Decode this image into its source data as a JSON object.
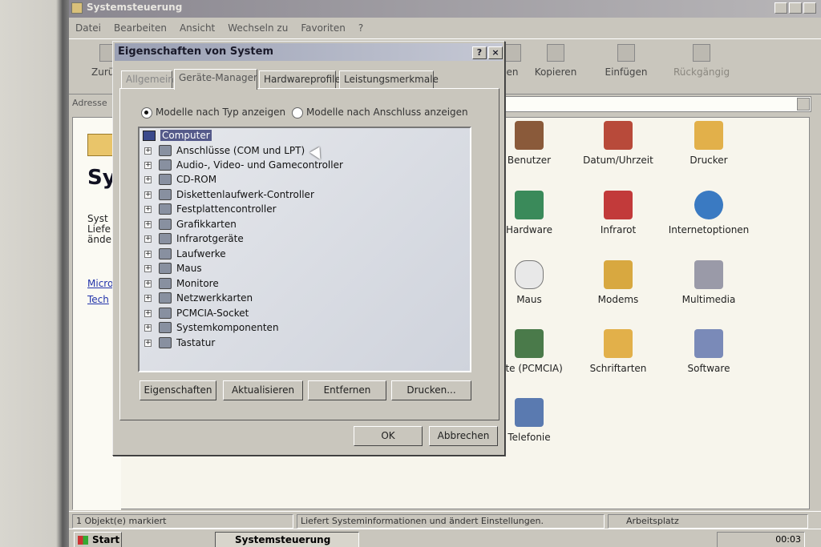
{
  "colors": {
    "dialog_title_bg": "#9aa0b4",
    "panel": "#c9c6bd",
    "selection": "#555a8a"
  },
  "control_panel": {
    "title": "Systemsteuerung",
    "menu": [
      "Datei",
      "Bearbeiten",
      "Ansicht",
      "Wechseln zu",
      "Favoriten",
      "?"
    ],
    "toolbar": [
      {
        "label": "Zurück",
        "icon": "back-arrow-icon"
      },
      {
        "label": "en",
        "icon": "cut-icon"
      },
      {
        "label": "Kopieren",
        "icon": "copy-icon"
      },
      {
        "label": "Einfügen",
        "icon": "paste-icon"
      },
      {
        "label": "Rückgängig",
        "icon": "undo-icon"
      }
    ],
    "address_label": "Adresse",
    "left_pane": {
      "heading": "Sy",
      "sub": "Syst\nLiefe\nände",
      "links": [
        "Micro",
        "Tech"
      ]
    },
    "icons": [
      {
        "label": "Benutzer",
        "icon": "users-icon",
        "color": "#8a5a3a"
      },
      {
        "label": "Datum/Uhrzeit",
        "icon": "calendar-clock-icon",
        "color": "#b84a3a"
      },
      {
        "label": "Drucker",
        "icon": "printer-folder-icon",
        "color": "#e2b04a"
      },
      {
        "label": "Hardware",
        "icon": "hardware-icon",
        "color": "#3a8a5a"
      },
      {
        "label": "Infrarot",
        "icon": "infrared-icon",
        "color": "#c23a3a"
      },
      {
        "label": "Internetoptionen",
        "icon": "globe-icon",
        "color": "#3a7ac2"
      },
      {
        "label": "Maus",
        "icon": "mouse-icon",
        "color": "#e8e8e8"
      },
      {
        "label": "Modems",
        "icon": "phone-modem-icon",
        "color": "#d8a840"
      },
      {
        "label": "Multimedia",
        "icon": "multimedia-icon",
        "color": "#9a9aa8"
      },
      {
        "label": "arte (PCMCIA)",
        "icon": "pcmcia-card-icon",
        "color": "#4a7a4a"
      },
      {
        "label": "Schriftarten",
        "icon": "fonts-folder-icon",
        "color": "#e2b04a"
      },
      {
        "label": "Software",
        "icon": "software-icon",
        "color": "#7a8ab8"
      },
      {
        "label": "Telefonie",
        "icon": "telephony-icon",
        "color": "#5a7ab0"
      }
    ],
    "status": {
      "selected": "1 Objekt(e) markiert",
      "description": "Liefert Systeminformationen und ändert Einstellungen.",
      "location": "Arbeitsplatz"
    },
    "taskbar": {
      "start": "Start",
      "task": "Systemsteuerung",
      "clock": "00:03"
    }
  },
  "dialog": {
    "title": "Eigenschaften von System",
    "help_btn": "?",
    "close_btn": "×",
    "tabs": [
      "Allgemein",
      "Geräte-Manager",
      "Hardwareprofile",
      "Leistungsmerkmale"
    ],
    "radio_by_type": "Modelle nach Typ anzeigen",
    "radio_by_connection": "Modelle nach Anschluss anzeigen",
    "tree_root": "Computer",
    "devices": [
      "Anschlüsse (COM und LPT)",
      "Audio-, Video- und Gamecontroller",
      "CD-ROM",
      "Diskettenlaufwerk-Controller",
      "Festplattencontroller",
      "Grafikkarten",
      "Infrarotgeräte",
      "Laufwerke",
      "Maus",
      "Monitore",
      "Netzwerkkarten",
      "PCMCIA-Socket",
      "Systemkomponenten",
      "Tastatur"
    ],
    "buttons": {
      "properties": "Eigenschaften",
      "refresh": "Aktualisieren",
      "remove": "Entfernen",
      "print": "Drucken...",
      "ok": "OK",
      "cancel": "Abbrechen"
    }
  }
}
